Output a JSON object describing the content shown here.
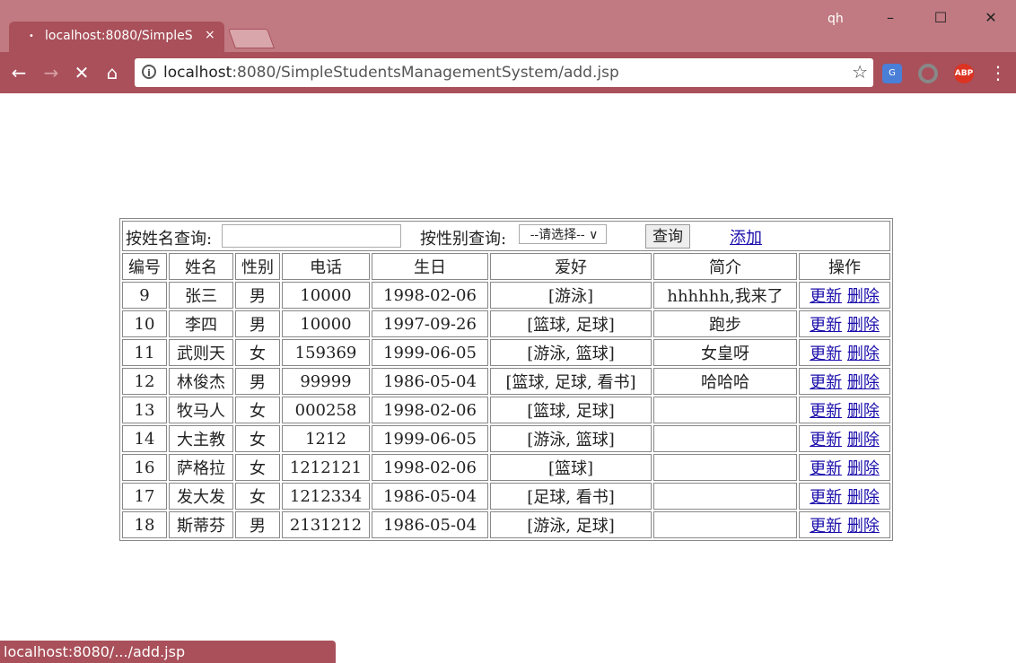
{
  "browser": {
    "tab_title": "localhost:8080/SimpleS",
    "tab_close": "×",
    "profile": "qh",
    "window_controls": [
      "–",
      "☐",
      "✕"
    ],
    "url_host": "localhost",
    "url_rest": ":8080/SimpleStudentsManagementSystem/add.jsp",
    "extensions": [
      "translate-icon",
      "circle-extension-icon",
      "adblock-plus-icon"
    ],
    "abp_label": "ABP",
    "status_text": "localhost:8080/.../add.jsp"
  },
  "search": {
    "name_label": "按姓名查询:",
    "name_value": "",
    "gender_label": "按性别查询:",
    "gender_selected": "--请选择--",
    "query_button": "查询",
    "add_link": "添加"
  },
  "table": {
    "columns": [
      "编号",
      "姓名",
      "性别",
      "电话",
      "生日",
      "爱好",
      "简介",
      "操作"
    ],
    "update_label": "更新",
    "delete_label": "删除",
    "rows": [
      {
        "id": "9",
        "name": "张三",
        "gender": "男",
        "phone": "10000",
        "birthday": "1998-02-06",
        "hobby": "[游泳]",
        "intro": "hhhhhh,我来了"
      },
      {
        "id": "10",
        "name": "李四",
        "gender": "男",
        "phone": "10000",
        "birthday": "1997-09-26",
        "hobby": "[篮球, 足球]",
        "intro": "跑步"
      },
      {
        "id": "11",
        "name": "武则天",
        "gender": "女",
        "phone": "159369",
        "birthday": "1999-06-05",
        "hobby": "[游泳, 篮球]",
        "intro": "女皇呀"
      },
      {
        "id": "12",
        "name": "林俊杰",
        "gender": "男",
        "phone": "99999",
        "birthday": "1986-05-04",
        "hobby": "[篮球, 足球, 看书]",
        "intro": "哈哈哈"
      },
      {
        "id": "13",
        "name": "牧马人",
        "gender": "女",
        "phone": "000258",
        "birthday": "1998-02-06",
        "hobby": "[篮球, 足球]",
        "intro": ""
      },
      {
        "id": "14",
        "name": "大主教",
        "gender": "女",
        "phone": "1212",
        "birthday": "1999-06-05",
        "hobby": "[游泳, 篮球]",
        "intro": ""
      },
      {
        "id": "16",
        "name": "萨格拉",
        "gender": "女",
        "phone": "1212121",
        "birthday": "1998-02-06",
        "hobby": "[篮球]",
        "intro": ""
      },
      {
        "id": "17",
        "name": "发大发",
        "gender": "女",
        "phone": "1212334",
        "birthday": "1986-05-04",
        "hobby": "[足球, 看书]",
        "intro": ""
      },
      {
        "id": "18",
        "name": "斯蒂芬",
        "gender": "男",
        "phone": "2131212",
        "birthday": "1986-05-04",
        "hobby": "[游泳, 足球]",
        "intro": ""
      }
    ]
  }
}
